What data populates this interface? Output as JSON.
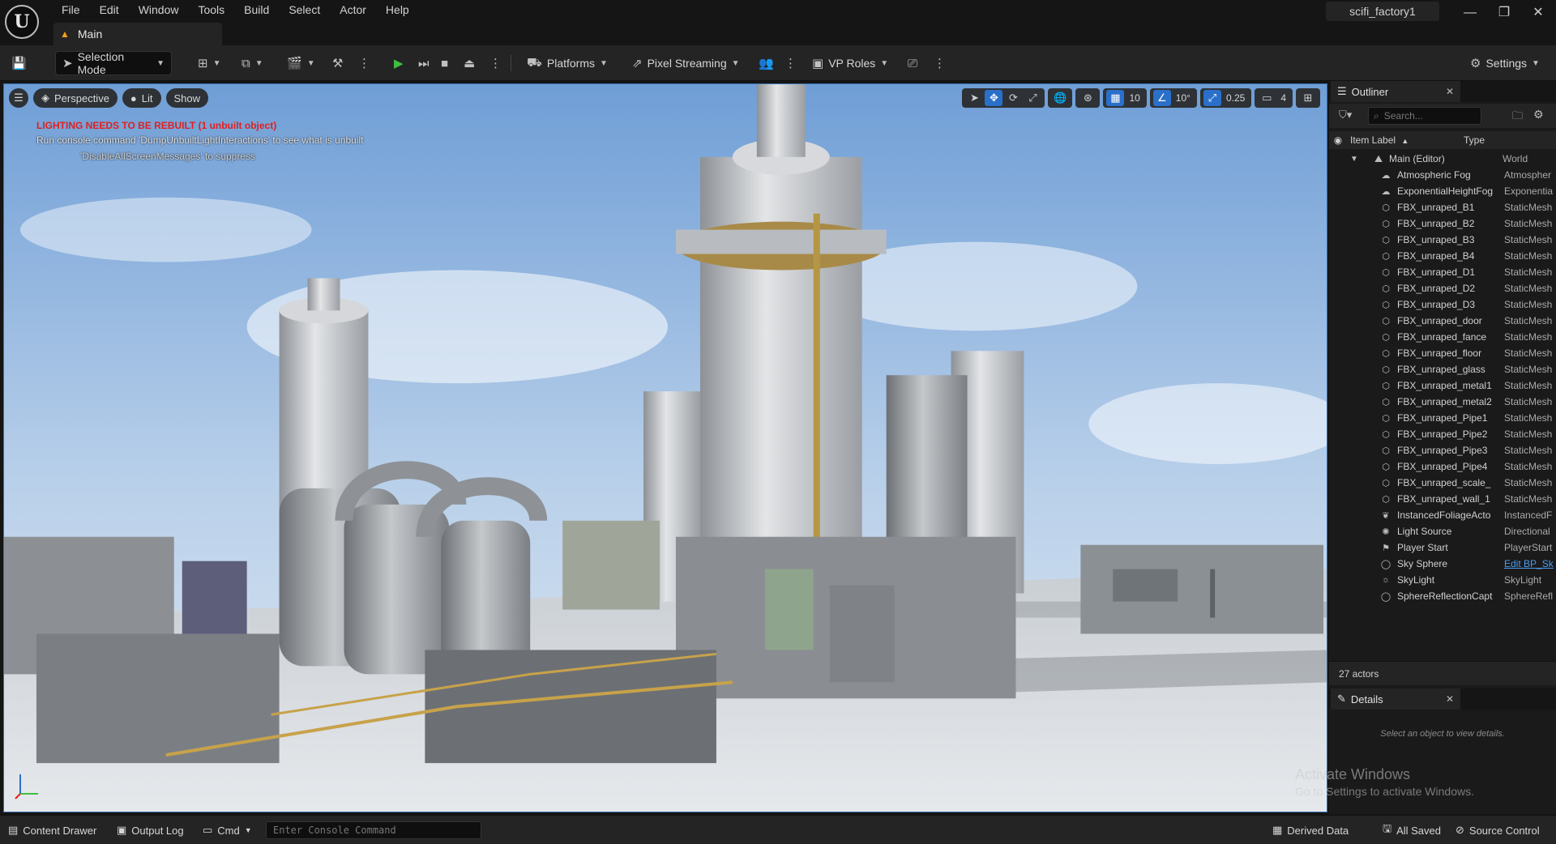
{
  "app": {
    "logo": "U",
    "project_name": "scifi_factory1",
    "tab_label": "Main"
  },
  "menu": [
    "File",
    "Edit",
    "Window",
    "Tools",
    "Build",
    "Select",
    "Actor",
    "Help"
  ],
  "window_controls": {
    "minimize": "—",
    "restore": "❐",
    "close": "✕"
  },
  "toolbar": {
    "selection_mode": "Selection Mode",
    "platforms": "Platforms",
    "pixel_streaming": "Pixel Streaming",
    "vp_roles": "VP Roles",
    "settings": "Settings"
  },
  "viewport": {
    "perspective": "Perspective",
    "lit": "Lit",
    "show": "Show",
    "grid_snap": "10",
    "rotation_snap": "10°",
    "scale_snap": "0.25",
    "camera_speed": "4",
    "warning_title": "LIGHTING NEEDS TO BE REBUILT (1 unbuilt object)",
    "warning_line2": "Run console command 'DumpUnbuiltLightInteractions' to see what is unbuilt",
    "warning_line3": "'DisableAllScreenMessages' to suppress"
  },
  "outliner": {
    "title": "Outliner",
    "search_placeholder": "Search...",
    "col_label": "Item Label",
    "col_sort": "▲",
    "col_type": "Type",
    "root": {
      "label": "Main (Editor)",
      "type": "World"
    },
    "items": [
      {
        "label": "Atmospheric Fog",
        "type": "Atmospher",
        "icon": "fog-icon"
      },
      {
        "label": "ExponentialHeightFog",
        "type": "Exponentia",
        "icon": "fog-icon"
      },
      {
        "label": "FBX_unraped_B1",
        "type": "StaticMesh",
        "icon": "mesh-icon"
      },
      {
        "label": "FBX_unraped_B2",
        "type": "StaticMesh",
        "icon": "mesh-icon"
      },
      {
        "label": "FBX_unraped_B3",
        "type": "StaticMesh",
        "icon": "mesh-icon"
      },
      {
        "label": "FBX_unraped_B4",
        "type": "StaticMesh",
        "icon": "mesh-icon"
      },
      {
        "label": "FBX_unraped_D1",
        "type": "StaticMesh",
        "icon": "mesh-icon"
      },
      {
        "label": "FBX_unraped_D2",
        "type": "StaticMesh",
        "icon": "mesh-icon"
      },
      {
        "label": "FBX_unraped_D3",
        "type": "StaticMesh",
        "icon": "mesh-icon"
      },
      {
        "label": "FBX_unraped_door",
        "type": "StaticMesh",
        "icon": "mesh-icon"
      },
      {
        "label": "FBX_unraped_fance",
        "type": "StaticMesh",
        "icon": "mesh-icon"
      },
      {
        "label": "FBX_unraped_floor",
        "type": "StaticMesh",
        "icon": "mesh-icon"
      },
      {
        "label": "FBX_unraped_glass",
        "type": "StaticMesh",
        "icon": "mesh-icon"
      },
      {
        "label": "FBX_unraped_metal1",
        "type": "StaticMesh",
        "icon": "mesh-icon"
      },
      {
        "label": "FBX_unraped_metal2",
        "type": "StaticMesh",
        "icon": "mesh-icon"
      },
      {
        "label": "FBX_unraped_Pipe1",
        "type": "StaticMesh",
        "icon": "mesh-icon"
      },
      {
        "label": "FBX_unraped_Pipe2",
        "type": "StaticMesh",
        "icon": "mesh-icon"
      },
      {
        "label": "FBX_unraped_Pipe3",
        "type": "StaticMesh",
        "icon": "mesh-icon"
      },
      {
        "label": "FBX_unraped_Pipe4",
        "type": "StaticMesh",
        "icon": "mesh-icon"
      },
      {
        "label": "FBX_unraped_scale_",
        "type": "StaticMesh",
        "icon": "mesh-icon"
      },
      {
        "label": "FBX_unraped_wall_1",
        "type": "StaticMesh",
        "icon": "mesh-icon"
      },
      {
        "label": "InstancedFoliageActo",
        "type": "InstancedF",
        "icon": "foliage-icon"
      },
      {
        "label": "Light Source",
        "type": "Directional",
        "icon": "sun-icon"
      },
      {
        "label": "Player Start",
        "type": "PlayerStart",
        "icon": "player-start-icon"
      },
      {
        "label": "Sky Sphere",
        "type": "Edit BP_Sk",
        "icon": "sphere-icon",
        "link": true
      },
      {
        "label": "SkyLight",
        "type": "SkyLight",
        "icon": "skylight-icon"
      },
      {
        "label": "SphereReflectionCapt",
        "type": "SphereRefl",
        "icon": "sphere-icon"
      }
    ],
    "actor_count": "27 actors"
  },
  "details": {
    "title": "Details",
    "empty_text": "Select an object to view details."
  },
  "watermark": {
    "title": "Activate Windows",
    "subtitle": "Go to Settings to activate Windows."
  },
  "statusbar": {
    "content_drawer": "Content Drawer",
    "output_log": "Output Log",
    "cmd": "Cmd",
    "console_placeholder": "Enter Console Command",
    "derived_data": "Derived Data",
    "all_saved": "All Saved",
    "source_control": "Source Control"
  },
  "colors": {
    "accent": "#2a6fc9",
    "warning": "#e02020",
    "play": "#3fbf3f",
    "panel": "#242424",
    "background": "#151515"
  }
}
